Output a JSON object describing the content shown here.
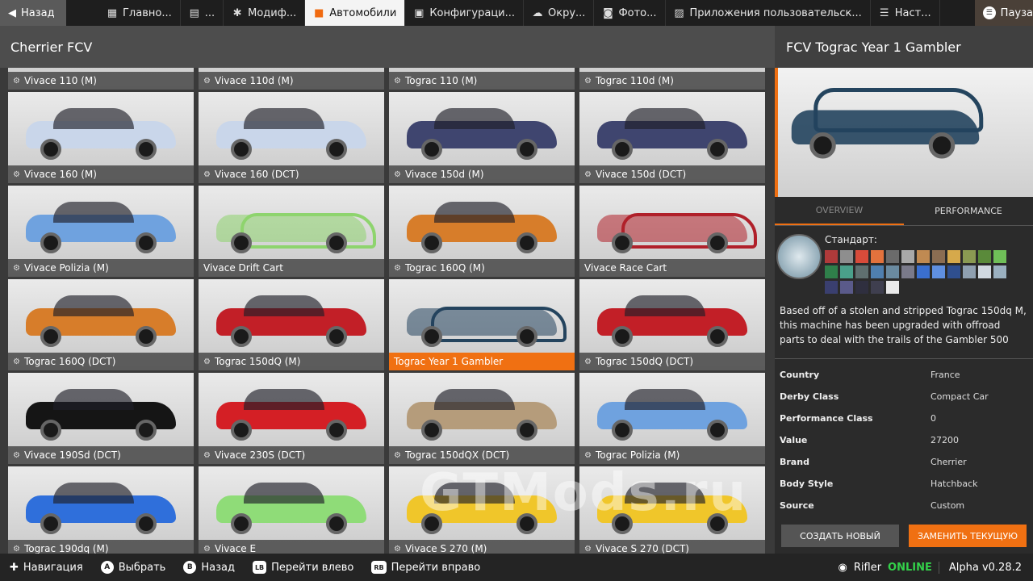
{
  "topbar": {
    "back_label": "Назад",
    "tabs": [
      {
        "label": "Главно...",
        "icon": "grid-icon"
      },
      {
        "label": "...",
        "icon": "map-icon"
      },
      {
        "label": "Модиф...",
        "icon": "gear-icon"
      },
      {
        "label": "Автомобили",
        "icon": "car-icon"
      },
      {
        "label": "Конфигураци...",
        "icon": "config-icon"
      },
      {
        "label": "Окру...",
        "icon": "weather-icon"
      },
      {
        "label": "Фото...",
        "icon": "camera-icon"
      },
      {
        "label": "Приложения пользовательск...",
        "icon": "apps-icon"
      },
      {
        "label": "Наст...",
        "icon": "sliders-icon"
      }
    ],
    "pause_label": "Пауза"
  },
  "left": {
    "title": "Cherrier FCV",
    "cars": [
      {
        "label": "Vivace 110 (M)",
        "color": "#c9d6ea"
      },
      {
        "label": "Vivace 110d (M)",
        "color": "#c9d6ea"
      },
      {
        "label": "Tograc 110 (M)",
        "color": "#9a9a9a"
      },
      {
        "label": "Tograc 110d (M)",
        "color": "#9a9a9a"
      },
      {
        "label": "Vivace 160 (M)",
        "color": "#c9d6ea"
      },
      {
        "label": "Vivace 160 (DCT)",
        "color": "#c9d6ea"
      },
      {
        "label": "Vivace 150d (M)",
        "color": "#3f456f"
      },
      {
        "label": "Vivace 150d (DCT)",
        "color": "#3f456f"
      },
      {
        "label": "Vivace Polizia (M)",
        "color": "#6fa2df"
      },
      {
        "label": "Vivace Drift Cart",
        "color": "#8ed46e"
      },
      {
        "label": "Tograc 160Q (M)",
        "color": "#d77d2a"
      },
      {
        "label": "Vivace Race Cart",
        "color": "#b0202a"
      },
      {
        "label": "Tograc 160Q (DCT)",
        "color": "#d77d2a"
      },
      {
        "label": "Tograc 150dQ (M)",
        "color": "#c21f27"
      },
      {
        "label": "Tograc Year 1 Gambler",
        "color": "#24445e"
      },
      {
        "label": "Tograc 150dQ (DCT)",
        "color": "#c21f27"
      },
      {
        "label": "Vivace 190Sd (DCT)",
        "color": "#151515"
      },
      {
        "label": "Vivace 230S (DCT)",
        "color": "#d41f25"
      },
      {
        "label": "Tograc 150dQX (DCT)",
        "color": "#b59c7b"
      },
      {
        "label": "Tograc Polizia (M)",
        "color": "#6fa2df"
      },
      {
        "label": "Tograc 190dq (M)",
        "color": "#2f6fdb"
      },
      {
        "label": "Vivace E",
        "color": "#8fdc78"
      },
      {
        "label": "Vivace S 270 (M)",
        "color": "#f0c62a"
      },
      {
        "label": "Vivace S 270 (DCT)",
        "color": "#f0c62a"
      }
    ]
  },
  "right": {
    "title": "FCV Tograc Year 1 Gambler",
    "tab_overview": "OVERVIEW",
    "tab_performance": "PERFORMANCE",
    "paint_title": "Стандарт:",
    "swatches": [
      "#b03a3a",
      "#8e8e8e",
      "#d84b3a",
      "#e3723d",
      "#6b6b6b",
      "#a9a9a9",
      "#c08a52",
      "#8b6d52",
      "#d6a94b",
      "#8a9a52",
      "#5a8a3a",
      "#6fbf58",
      "#2f7f4a",
      "#4aa08a",
      "#5f6f6f",
      "#4f7faf",
      "#6a8aa0",
      "#7a7a8a",
      "#3a6fd0",
      "#5f8fe0",
      "#2f4f8f",
      "#8fa0b0",
      "#d0d8e0",
      "#9ab0c0",
      "#3a3f6f",
      "#5a5a8a",
      "#2f2f3f",
      "#3f3f4f",
      "#eaeaea"
    ],
    "description": "Based off of a stolen and stripped Tograc 150dq M, this machine has been upgraded with offroad parts to deal with the trails of the Gambler 500",
    "specs": [
      {
        "key": "Country",
        "value": "France"
      },
      {
        "key": "Derby Class",
        "value": "Compact Car"
      },
      {
        "key": "Performance Class",
        "value": "0"
      },
      {
        "key": "Value",
        "value": "27200"
      },
      {
        "key": "Brand",
        "value": "Cherrier"
      },
      {
        "key": "Body Style",
        "value": "Hatchback"
      },
      {
        "key": "Source",
        "value": "Custom"
      }
    ],
    "btn_new": "СОЗДАТЬ НОВЫЙ",
    "btn_replace": "ЗАМЕНИТЬ ТЕКУЩУЮ"
  },
  "bottombar": {
    "nav": "Навигация",
    "select": "Выбрать",
    "select_key": "A",
    "back": "Назад",
    "back_key": "B",
    "left": "Перейти влево",
    "left_key": "LB",
    "right": "Перейти вправо",
    "right_key": "RB",
    "user": "Rifler",
    "status": "ONLINE",
    "version": "Alpha v0.28.2"
  },
  "watermark": "GTMods.ru",
  "accent_color": "#f07012"
}
